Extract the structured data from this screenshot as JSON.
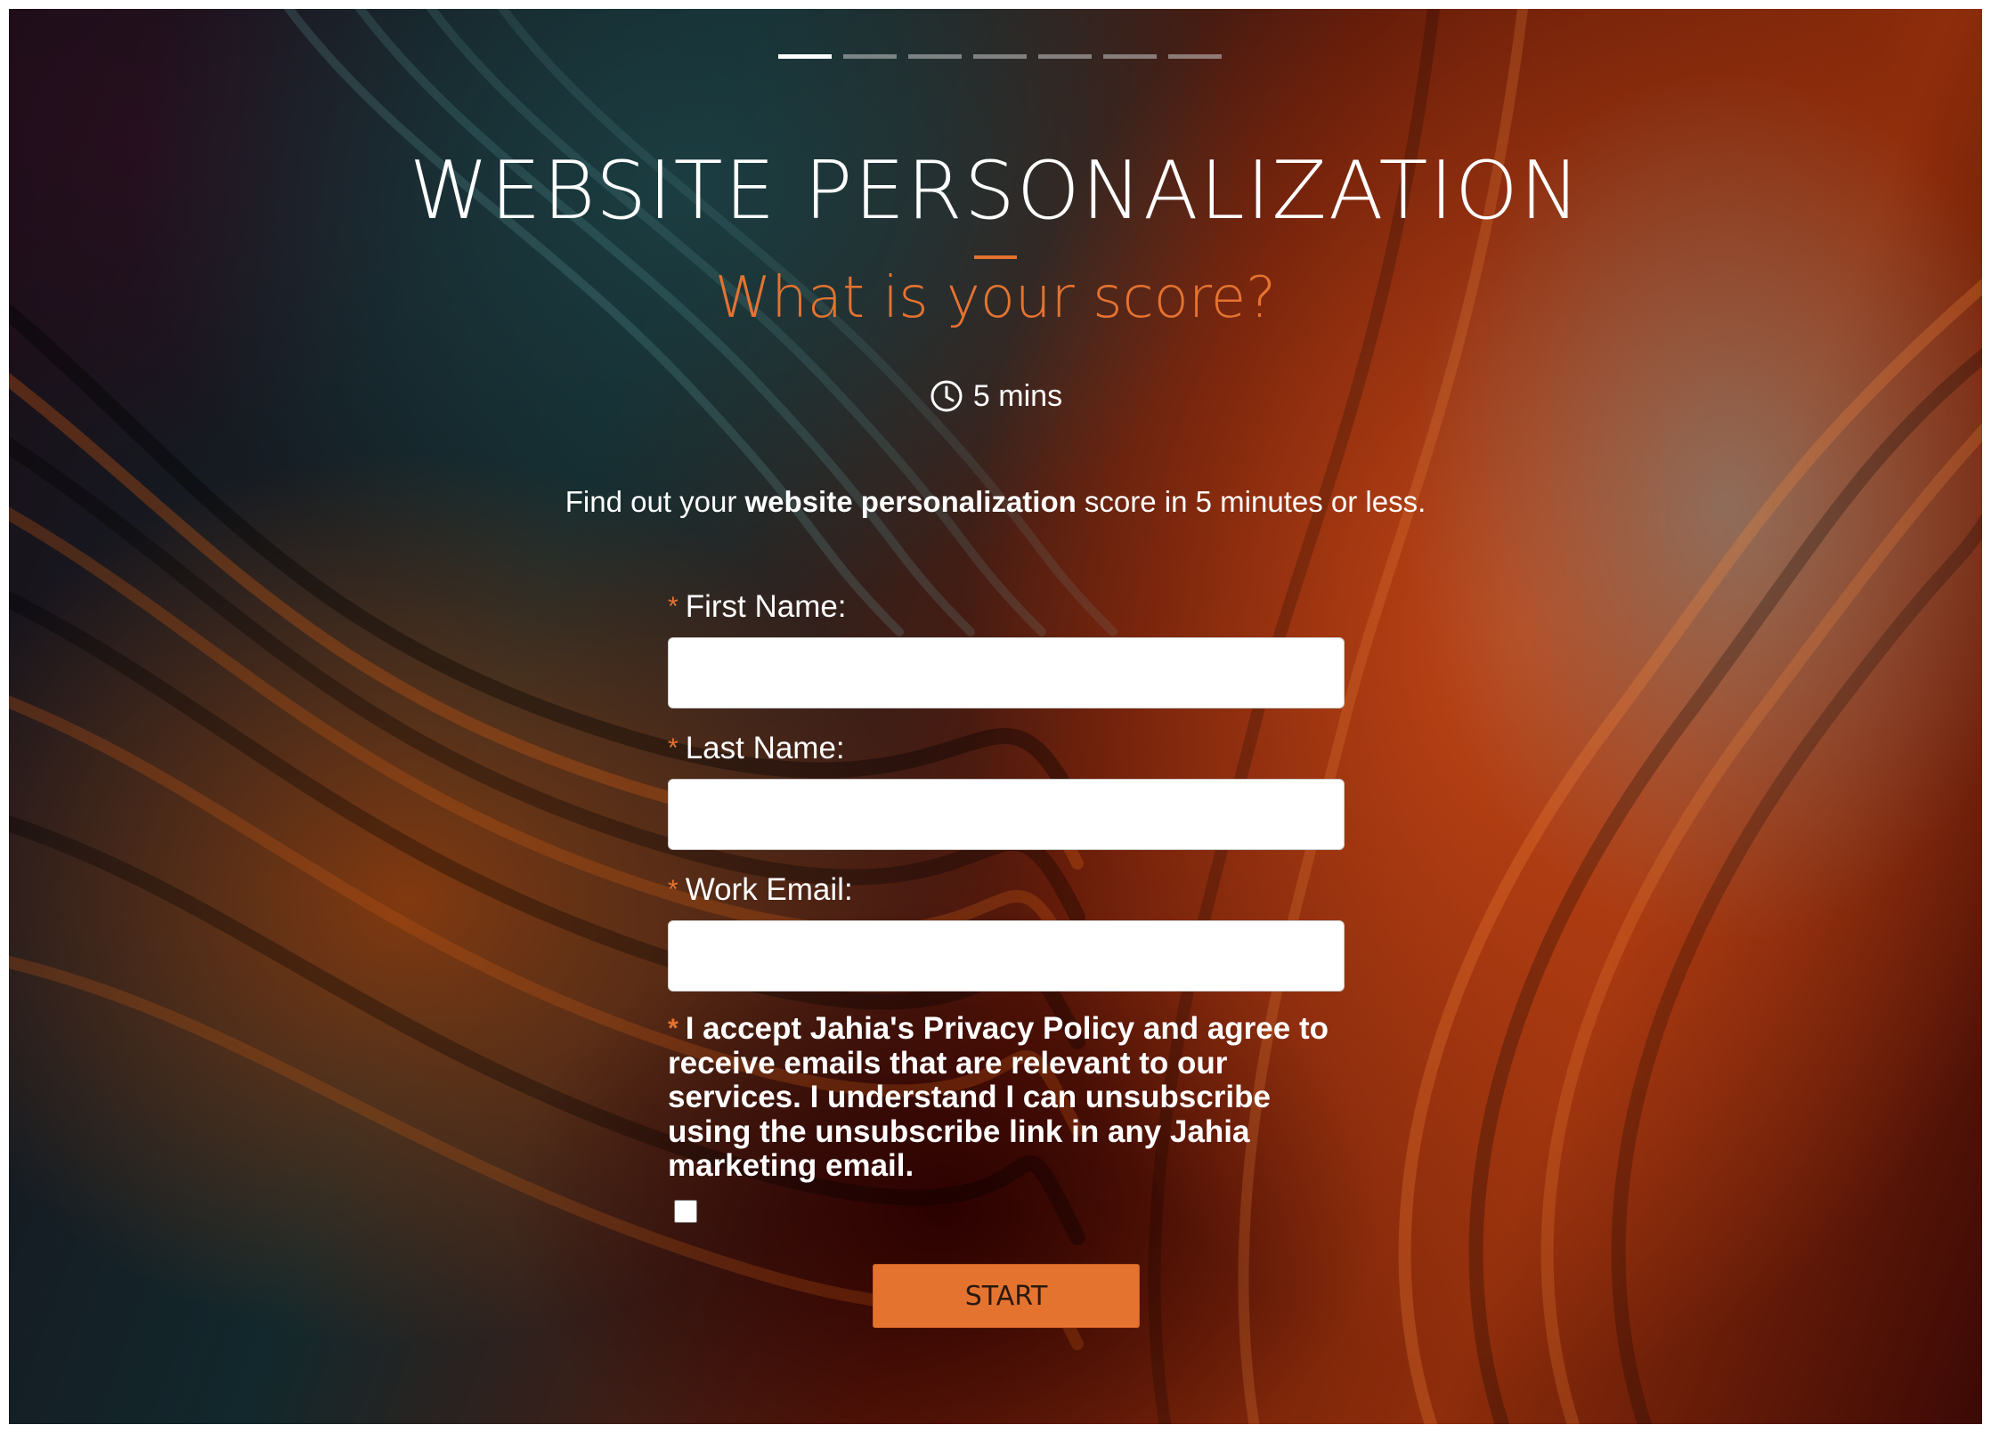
{
  "progress": {
    "total_steps": 7,
    "current_step": 1
  },
  "header": {
    "title": "WEBSITE PERSONALIZATION",
    "subtitle": "What is your score?",
    "duration_icon": "clock-icon",
    "duration": "5 mins"
  },
  "intro": {
    "prefix": "Find out your ",
    "emphasis": "website personalization",
    "suffix": " score in 5 minutes or less."
  },
  "form": {
    "required_marker": "*",
    "fields": [
      {
        "label": "First Name:",
        "value": ""
      },
      {
        "label": "Last Name:",
        "value": ""
      },
      {
        "label": "Work Email:",
        "value": ""
      }
    ],
    "consent_text": "I accept Jahia's Privacy Policy and agree to receive emails that are relevant to our services. I understand I can unsubscribe using the unsubscribe link in any Jahia marketing email.",
    "consent_checked": false,
    "submit_label": "START"
  },
  "colors": {
    "accent": "#e57330",
    "text": "#ffffff",
    "input_bg": "#ffffff"
  }
}
